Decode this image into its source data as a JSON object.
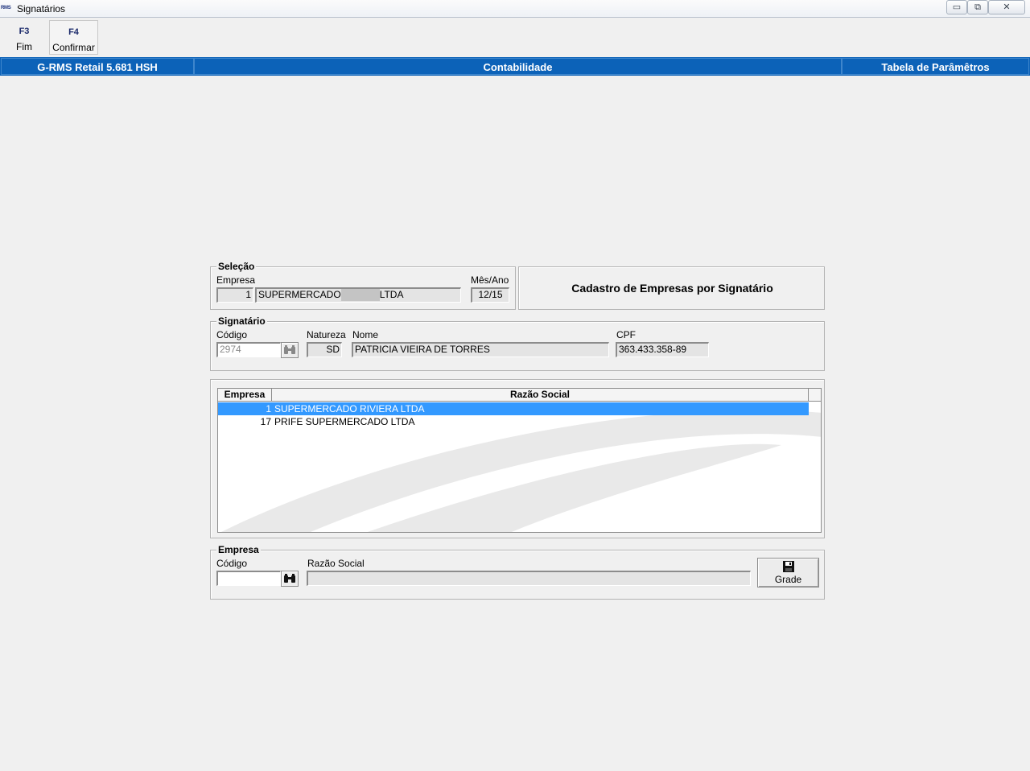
{
  "window": {
    "icon_text": "RMS",
    "title": "Signatários",
    "minimize_glyph": "▭",
    "restore_glyph": "⧉",
    "close_glyph": "✕"
  },
  "toolbar": {
    "buttons": [
      {
        "key": "F3",
        "label": "Fim"
      },
      {
        "key": "F4",
        "label": "Confirmar"
      }
    ]
  },
  "header_bar": {
    "app": "G-RMS Retail 5.681 HSH",
    "module": "Contabilidade",
    "section": "Tabela de Parâmêtros"
  },
  "selecao": {
    "title": "Seleção",
    "empresa_label": "Empresa",
    "empresa_code": "1",
    "empresa_name_prefix": "SUPERMERCADO",
    "empresa_name_suffix": "LTDA",
    "mes_ano_label": "Mês/Ano",
    "mes_ano": "12/15"
  },
  "heading": "Cadastro de Empresas por Signatário",
  "signatario": {
    "title": "Signatário",
    "codigo_label": "Código",
    "codigo": "2974",
    "natureza_label": "Natureza",
    "natureza": "SD",
    "nome_label": "Nome",
    "nome": "PATRICIA VIEIRA DE TORRES",
    "cpf_label": "CPF",
    "cpf": "363.433.358-89",
    "lookup_icon": "binoculars-icon"
  },
  "grid": {
    "columns": [
      "Empresa",
      "Razão Social"
    ],
    "rows": [
      {
        "empresa": "1",
        "razao_social": "SUPERMERCADO RIVIERA LTDA",
        "selected": true
      },
      {
        "empresa": "17",
        "razao_social": "PRIFE SUPERMERCADO LTDA",
        "selected": false
      }
    ]
  },
  "empresa_box": {
    "title": "Empresa",
    "codigo_label": "Código",
    "codigo": "",
    "razao_social_label": "Razão Social",
    "razao_social": "",
    "grade_label": "Grade",
    "grade_icon": "floppy-disk-icon"
  },
  "colors": {
    "header_bar": "#0c62b8",
    "selection": "#3399ff",
    "window_bg": "#f0f0f0"
  }
}
